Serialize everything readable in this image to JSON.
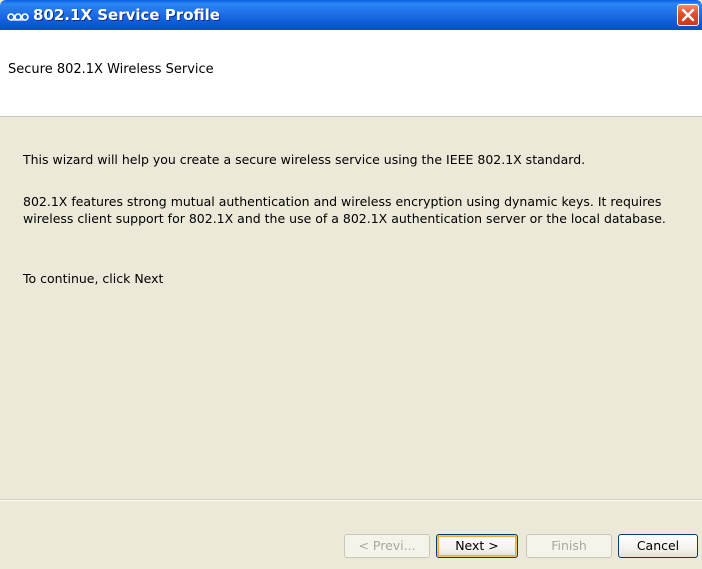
{
  "window": {
    "title": "802.1X Service Profile",
    "icon": "network-link-icon"
  },
  "header": {
    "title": "Secure 802.1X Wireless Service"
  },
  "content": {
    "paragraphs": [
      "This wizard will help you create a secure wireless service using the IEEE 802.1X standard.",
      "802.1X features strong mutual authentication and wireless encryption using dynamic keys. It requires wireless client support for 802.1X and the use of a 802.1X authentication server or the local database.",
      "To continue, click Next"
    ]
  },
  "buttons": {
    "prev": "< Previ...",
    "next": "Next >",
    "finish": "Finish",
    "cancel": "Cancel"
  },
  "colors": {
    "titlebar": "#0b4ec4",
    "dialog_background": "#ece9d8",
    "close_button": "#e2522d",
    "default_button_highlight": "#f6a83a",
    "disabled_text": "#aca899"
  }
}
